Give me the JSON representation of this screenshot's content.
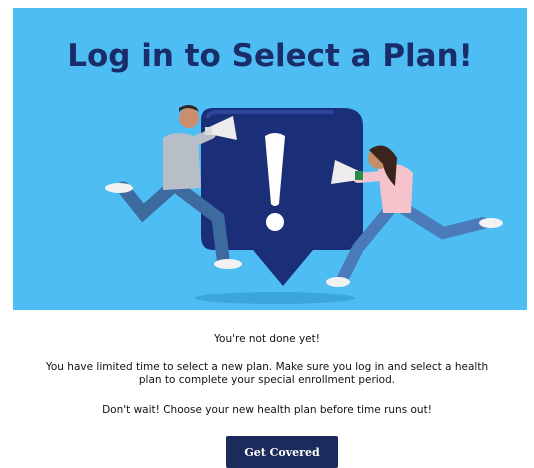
{
  "hero": {
    "title": "Log in to Select a Plan!",
    "background_color": "#4dbdf3",
    "image": "two-people-megaphones-exclamation-bubble"
  },
  "content": {
    "line1": "You're not done yet!",
    "line2": "You have limited time to select a new plan. Make sure you log in and select a health plan to complete your special enrollment period.",
    "line3": "Don't wait! Choose your new health plan before time runs out!"
  },
  "cta": {
    "label": "Get Covered",
    "color": "#1b2b5c"
  }
}
